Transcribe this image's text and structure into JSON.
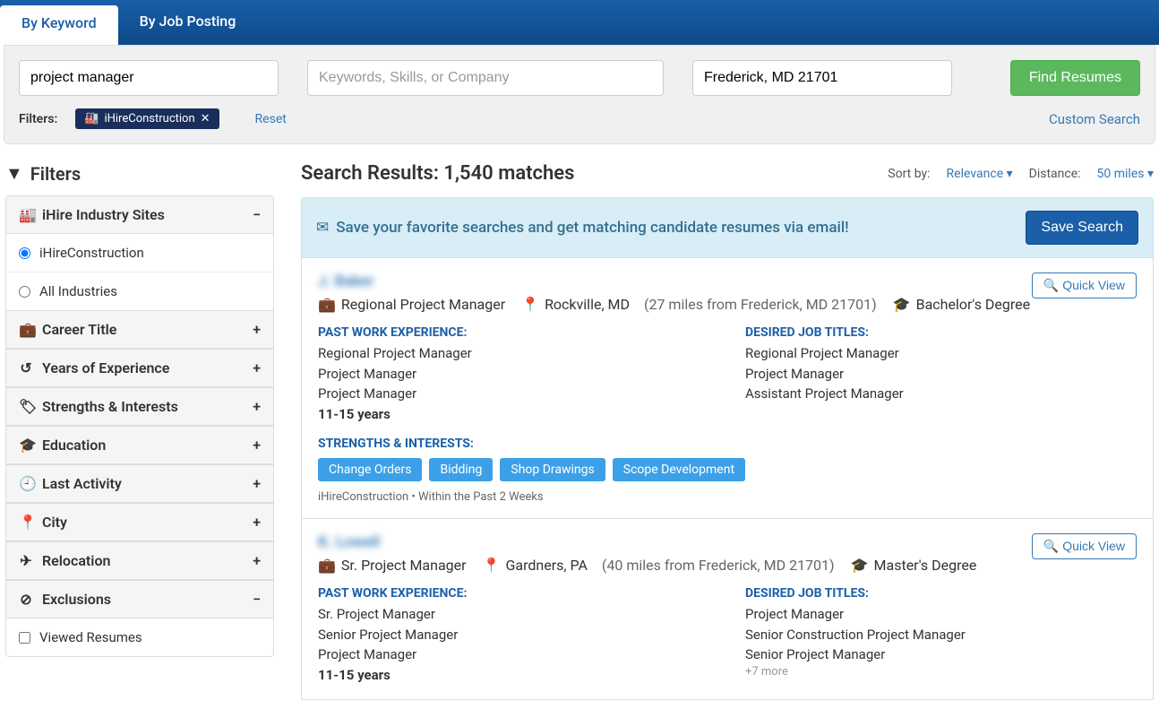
{
  "tabs": {
    "by_keyword": "By Keyword",
    "by_posting": "By Job Posting"
  },
  "search": {
    "keyword_value": "project manager",
    "extra_placeholder": "Keywords, Skills, or Company",
    "location_value": "Frederick, MD 21701",
    "find_button": "Find Resumes",
    "filters_label": "Filters:",
    "filter_tag": "iHireConstruction",
    "reset": "Reset",
    "custom": "Custom Search"
  },
  "sidebar": {
    "heading": "Filters",
    "industry_title": "iHire Industry Sites",
    "industry_options": [
      "iHireConstruction",
      "All Industries"
    ],
    "sections": {
      "career": "Career Title",
      "years": "Years of Experience",
      "strengths": "Strengths & Interests",
      "edu": "Education",
      "activity": "Last Activity",
      "city": "City",
      "relocation": "Relocation",
      "exclusions": "Exclusions"
    },
    "viewed": "Viewed Resumes"
  },
  "results": {
    "title": "Search Results: 1,540 matches",
    "sort_by_label": "Sort by:",
    "sort_by_value": "Relevance",
    "distance_label": "Distance:",
    "distance_value": "50 miles"
  },
  "banner": {
    "text": "Save your favorite searches and get matching candidate resumes via email!",
    "button": "Save Search"
  },
  "quick_view": "Quick View",
  "labels": {
    "past_exp": "PAST WORK EXPERIENCE:",
    "desired": "DESIRED JOB TITLES:",
    "strengths": "STRENGTHS & INTERESTS:"
  },
  "candidates": [
    {
      "name": "J. Baker",
      "title": "Regional Project Manager",
      "location": "Rockville, MD",
      "distance": "(27 miles from Frederick, MD 21701)",
      "degree": "Bachelor's Degree",
      "past": [
        "Regional Project Manager",
        "Project Manager",
        "Project Manager"
      ],
      "years": "11-15 years",
      "desired": [
        "Regional Project Manager",
        "Project Manager",
        "Assistant Project Manager"
      ],
      "tags": [
        "Change Orders",
        "Bidding",
        "Shop Drawings",
        "Scope Development"
      ],
      "footer": "iHireConstruction • Within the Past 2 Weeks"
    },
    {
      "name": "K. Lowell",
      "title": "Sr. Project Manager",
      "location": "Gardners, PA",
      "distance": "(40 miles from Frederick, MD 21701)",
      "degree": "Master's Degree",
      "past": [
        "Sr. Project Manager",
        "Senior Project Manager",
        "Project Manager"
      ],
      "years": "11-15 years",
      "desired": [
        "Project Manager",
        "Senior Construction Project Manager",
        "Senior Project Manager"
      ],
      "more": "+7 more"
    }
  ]
}
